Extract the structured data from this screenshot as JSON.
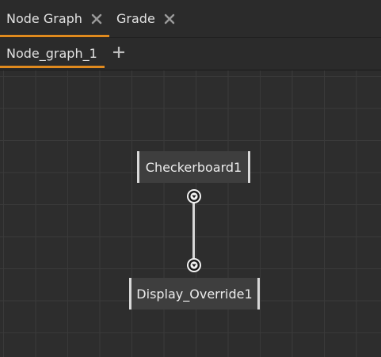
{
  "panel_tabs": [
    {
      "label": "Node Graph",
      "active": true,
      "close_icon": "close-icon"
    },
    {
      "label": "Grade",
      "active": false,
      "close_icon": "close-icon"
    }
  ],
  "graph_tabs": [
    {
      "label": "Node_graph_1",
      "active": true
    }
  ],
  "add_tab_icon": "plus-icon",
  "nodes": {
    "checkerboard": {
      "label": "Checkerboard1"
    },
    "display": {
      "label": "Display_Override1"
    }
  },
  "ports": {
    "output": {
      "icon": "chevron-down-icon"
    },
    "input": {
      "icon": "chevron-down-icon"
    }
  },
  "colors": {
    "accent": "#e08a1e",
    "background": "#2c2c2c",
    "grid": "#3a3a3a",
    "node_fill": "#3e3e3e",
    "node_edge": "#d9d9d9",
    "text": "#e2e2e2"
  }
}
